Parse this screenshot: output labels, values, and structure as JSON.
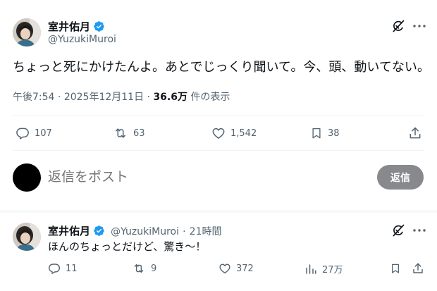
{
  "main_post": {
    "display_name": "室井佑月",
    "handle": "@YuzukiMuroi",
    "text": "ちょっと死にかけたんよ。あとでじっくり聞いて。今、頭、動いてない。",
    "time": "午後7:54",
    "sep1": "·",
    "date": "2025年12月11日",
    "sep2": "·",
    "views": "36.6万",
    "views_suffix": "件の表示",
    "stats": {
      "replies": "107",
      "reposts": "63",
      "likes": "1,542",
      "bookmarks": "38"
    }
  },
  "composer": {
    "placeholder": "返信をポスト",
    "button_label": "返信"
  },
  "reply_post": {
    "display_name": "室井佑月",
    "handle": "@YuzukiMuroi",
    "sep": "·",
    "time": "21時間",
    "text": "ほんのちょっとだけど、驚き〜！",
    "stats": {
      "replies": "11",
      "reposts": "9",
      "likes": "372",
      "views": "27万"
    }
  },
  "colors": {
    "verified": "#1d9bf0",
    "text_primary": "#0f1419",
    "text_secondary": "#536471",
    "divider": "#eff3f4",
    "reply_button": "#87898c"
  },
  "icons": {
    "verified": "verified-badge-icon",
    "grok": "grok-icon",
    "more": "more-icon",
    "reply": "reply-icon",
    "repost": "repost-icon",
    "like": "like-icon",
    "bookmark": "bookmark-icon",
    "share": "share-icon",
    "views": "views-icon"
  }
}
